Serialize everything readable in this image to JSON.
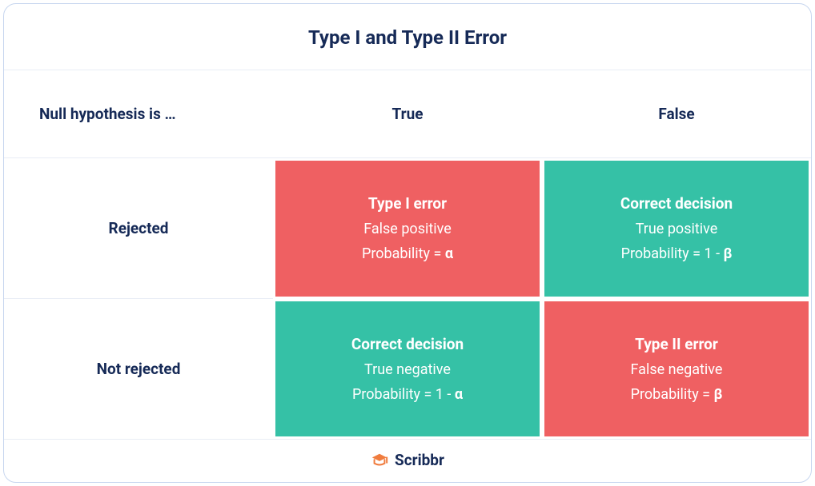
{
  "title": "Type I and Type II Error",
  "headers": {
    "row_label": "Null hypothesis is …",
    "col_true": "True",
    "col_false": "False"
  },
  "rows": {
    "rejected": {
      "label": "Rejected",
      "true_cell": {
        "title": "Type I error",
        "subtitle": "False positive",
        "prob_prefix": "Probability = ",
        "prob_symbol": "α",
        "color": "red"
      },
      "false_cell": {
        "title": "Correct decision",
        "subtitle": "True positive",
        "prob_prefix": "Probability = 1 - ",
        "prob_symbol": "β",
        "color": "green"
      }
    },
    "not_rejected": {
      "label": "Not rejected",
      "true_cell": {
        "title": "Correct decision",
        "subtitle": "True negative",
        "prob_prefix": "Probability = 1 - ",
        "prob_symbol": "α",
        "color": "green"
      },
      "false_cell": {
        "title": "Type II error",
        "subtitle": "False negative",
        "prob_prefix": "Probability = ",
        "prob_symbol": "β",
        "color": "red"
      }
    }
  },
  "footer": {
    "brand": "Scribbr",
    "icon_color": "#f07c3e"
  }
}
